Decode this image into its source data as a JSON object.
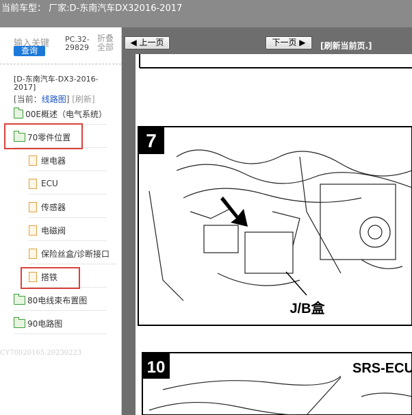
{
  "header": {
    "title": "当前车型： 厂家:D-东南汽车DX32016-2017"
  },
  "search": {
    "keyword_label": "输入关键",
    "query_button": "查询",
    "pc_code": "PC.32-29829",
    "fold_all": "折叠全部"
  },
  "vehicle": {
    "title": "[D-东南汽车-DX3-2016-2017]",
    "current_prefix": "[当前：",
    "current_link": "线路图",
    "current_suffix": "]",
    "refresh": "[刷新]"
  },
  "tree": [
    {
      "label": "00E概述（电气系统）",
      "type": "folder"
    },
    {
      "label": "70零件位置",
      "type": "folder-open"
    },
    {
      "label": "继电器",
      "type": "doc"
    },
    {
      "label": "ECU",
      "type": "doc"
    },
    {
      "label": "传感器",
      "type": "doc"
    },
    {
      "label": "电磁阀",
      "type": "doc"
    },
    {
      "label": "保险丝盒/诊断接口",
      "type": "doc"
    },
    {
      "label": "搭铁",
      "type": "doc"
    },
    {
      "label": "80电线束布置图",
      "type": "folder"
    },
    {
      "label": "90电路图",
      "type": "folder"
    }
  ],
  "watermark": "CY70020165.20230223",
  "toolbar": {
    "prev": "上一页",
    "next": "下一页",
    "refresh": "[刷新当前页.]"
  },
  "figures": [
    {
      "number": "7",
      "label": "J/B盒"
    },
    {
      "number": "10",
      "label": "SRS-ECU"
    }
  ],
  "colors": {
    "topbar": "#8a8a8a",
    "highlight": "#d9413b",
    "query_button": "#1c79d8"
  }
}
